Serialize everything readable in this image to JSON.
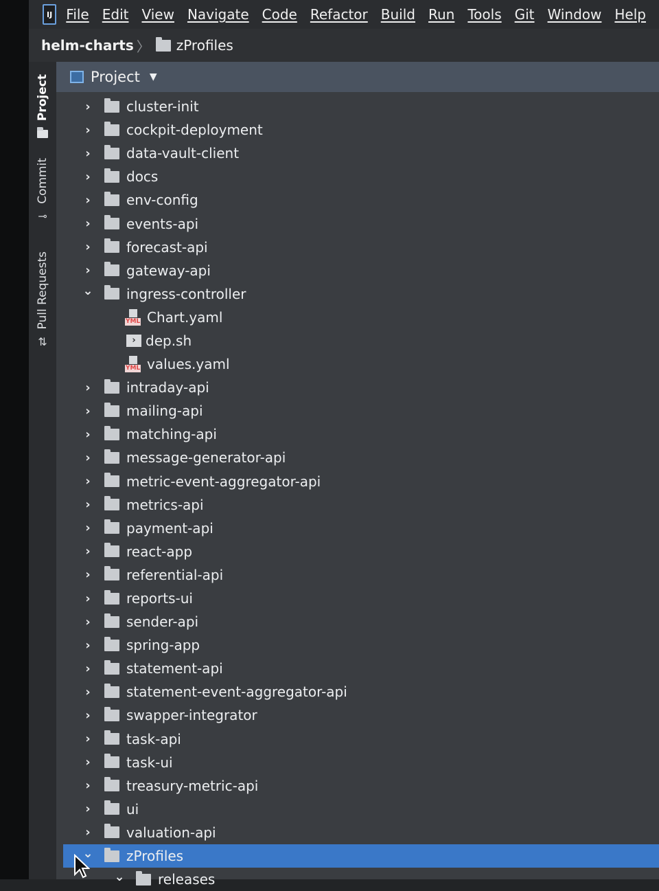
{
  "menubar": {
    "logo": "IJ",
    "items": [
      "File",
      "Edit",
      "View",
      "Navigate",
      "Code",
      "Refactor",
      "Build",
      "Run",
      "Tools",
      "Git",
      "Window",
      "Help"
    ]
  },
  "breadcrumb": {
    "root": "helm-charts",
    "separator": "〉",
    "current": "zProfiles"
  },
  "leftbar": {
    "tabs": [
      {
        "label": "Project",
        "icon": "folder-icon"
      },
      {
        "label": "Commit",
        "icon": "commit-icon"
      },
      {
        "label": "Pull Requests",
        "icon": "pull-request-icon"
      }
    ]
  },
  "panel": {
    "title": "Project",
    "dropdown": "▼"
  },
  "tree": [
    {
      "name": "cluster-init",
      "type": "folder",
      "expanded": false
    },
    {
      "name": "cockpit-deployment",
      "type": "folder",
      "expanded": false
    },
    {
      "name": "data-vault-client",
      "type": "folder",
      "expanded": false
    },
    {
      "name": "docs",
      "type": "folder",
      "expanded": false
    },
    {
      "name": "env-config",
      "type": "folder",
      "expanded": false
    },
    {
      "name": "events-api",
      "type": "folder",
      "expanded": false
    },
    {
      "name": "forecast-api",
      "type": "folder",
      "expanded": false
    },
    {
      "name": "gateway-api",
      "type": "folder",
      "expanded": false
    },
    {
      "name": "ingress-controller",
      "type": "folder",
      "expanded": true
    },
    {
      "name": "Chart.yaml",
      "type": "yaml",
      "child": true
    },
    {
      "name": "dep.sh",
      "type": "sh",
      "child": true
    },
    {
      "name": "values.yaml",
      "type": "yaml",
      "child": true
    },
    {
      "name": "intraday-api",
      "type": "folder",
      "expanded": false
    },
    {
      "name": "mailing-api",
      "type": "folder",
      "expanded": false
    },
    {
      "name": "matching-api",
      "type": "folder",
      "expanded": false
    },
    {
      "name": "message-generator-api",
      "type": "folder",
      "expanded": false
    },
    {
      "name": "metric-event-aggregator-api",
      "type": "folder",
      "expanded": false
    },
    {
      "name": "metrics-api",
      "type": "folder",
      "expanded": false
    },
    {
      "name": "payment-api",
      "type": "folder",
      "expanded": false
    },
    {
      "name": "react-app",
      "type": "folder",
      "expanded": false
    },
    {
      "name": "referential-api",
      "type": "folder",
      "expanded": false
    },
    {
      "name": "reports-ui",
      "type": "folder",
      "expanded": false
    },
    {
      "name": "sender-api",
      "type": "folder",
      "expanded": false
    },
    {
      "name": "spring-app",
      "type": "folder",
      "expanded": false
    },
    {
      "name": "statement-api",
      "type": "folder",
      "expanded": false
    },
    {
      "name": "statement-event-aggregator-api",
      "type": "folder",
      "expanded": false
    },
    {
      "name": "swapper-integrator",
      "type": "folder",
      "expanded": false
    },
    {
      "name": "task-api",
      "type": "folder",
      "expanded": false
    },
    {
      "name": "task-ui",
      "type": "folder",
      "expanded": false
    },
    {
      "name": "treasury-metric-api",
      "type": "folder",
      "expanded": false
    },
    {
      "name": "ui",
      "type": "folder",
      "expanded": false
    },
    {
      "name": "valuation-api",
      "type": "folder",
      "expanded": false
    },
    {
      "name": "zProfiles",
      "type": "folder",
      "expanded": true,
      "selected": true
    },
    {
      "name": "releases",
      "type": "folder",
      "expanded": true,
      "depth": 2
    }
  ],
  "colors": {
    "selection": "#3a78c8",
    "panel_header": "#4a5360",
    "yaml_tag": "#e04848"
  }
}
